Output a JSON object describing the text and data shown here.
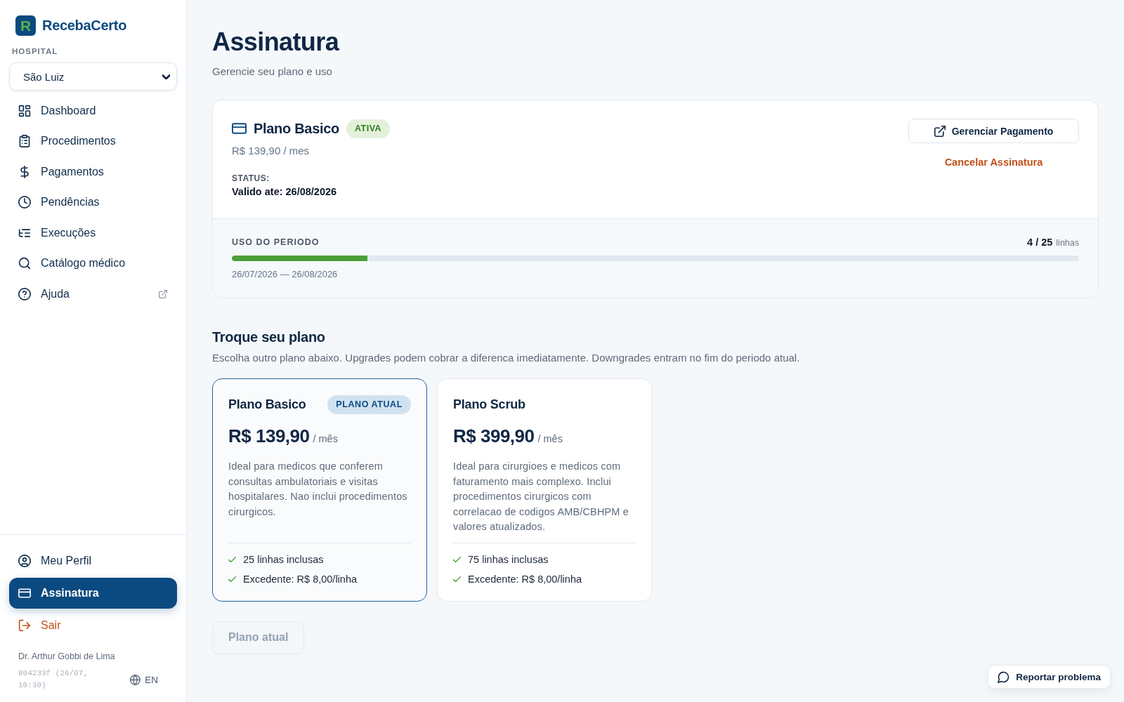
{
  "brand": {
    "logo_letter": "R",
    "name": "RecebaCerto"
  },
  "sidebar": {
    "hospital_label": "HOSPITAL",
    "hospital_select": {
      "value": "São Luiz"
    },
    "nav": [
      {
        "label": "Dashboard",
        "selected": false,
        "external": false
      },
      {
        "label": "Procedimentos",
        "selected": false,
        "external": false
      },
      {
        "label": "Pagamentos",
        "selected": false,
        "external": false
      },
      {
        "label": "Pendências",
        "selected": false,
        "external": false
      },
      {
        "label": "Execuções",
        "selected": false,
        "external": false
      },
      {
        "label": "Catálogo médico",
        "selected": false,
        "external": false
      },
      {
        "label": "Ajuda",
        "selected": false,
        "external": true
      }
    ],
    "bottom_nav": [
      {
        "label": "Meu Perfil",
        "kind": "link",
        "selected": false
      },
      {
        "label": "Assinatura",
        "kind": "link",
        "selected": true
      },
      {
        "label": "Sair",
        "kind": "danger",
        "selected": false
      }
    ],
    "user": "Dr. Arthur Gobbi de Lima",
    "build": "804233f (26/07, 10:30)",
    "language": "EN"
  },
  "page": {
    "title": "Assinatura",
    "subtitle": "Gerencie seu plano e uso"
  },
  "subscription": {
    "plan_name": "Plano Basico",
    "badge": "ATIVA",
    "price": "R$ 139,90 / mes",
    "status_label": "STATUS:",
    "status_value": "Valido ate: 26/08/2026",
    "manage_button": "Gerenciar Pagamento",
    "cancel_link": "Cancelar Assinatura",
    "usage": {
      "label": "USO DO PERIODO",
      "count": "4 / 25",
      "unit": "linhas",
      "level": 0.16,
      "period": "26/07/2026 — 26/08/2026"
    }
  },
  "change_plan": {
    "title": "Troque seu plano",
    "description": "Escolha outro plano abaixo. Upgrades podem cobrar a diferenca imediatamente. Downgrades entram no fim do periodo atual.",
    "plans": [
      {
        "name": "Plano Basico",
        "badge": "PLANO ATUAL",
        "price": "R$ 139,90",
        "period": "/ mês",
        "description": "Ideal para medicos que conferem consultas ambulatoriais e visitas hospitalares. Nao inclui procedimentos cirurgicos.",
        "features": [
          "25 linhas inclusas",
          "Excedente: R$ 8,00/linha"
        ],
        "selected": true
      },
      {
        "name": "Plano Scrub",
        "price": "R$ 399,90",
        "period": "/ mês",
        "description": "Ideal para cirurgioes e medicos com faturamento mais complexo. Inclui procedimentos cirurgicos com correlacao de codigos AMB/CBHPM e valores atualizados.",
        "features": [
          "75 linhas inclusas",
          "Excedente: R$ 8,00/linha"
        ],
        "selected": false
      }
    ],
    "action_button": {
      "label": "Plano atual",
      "disabled": true
    }
  },
  "report_button": {
    "label": "Reportar problema"
  }
}
